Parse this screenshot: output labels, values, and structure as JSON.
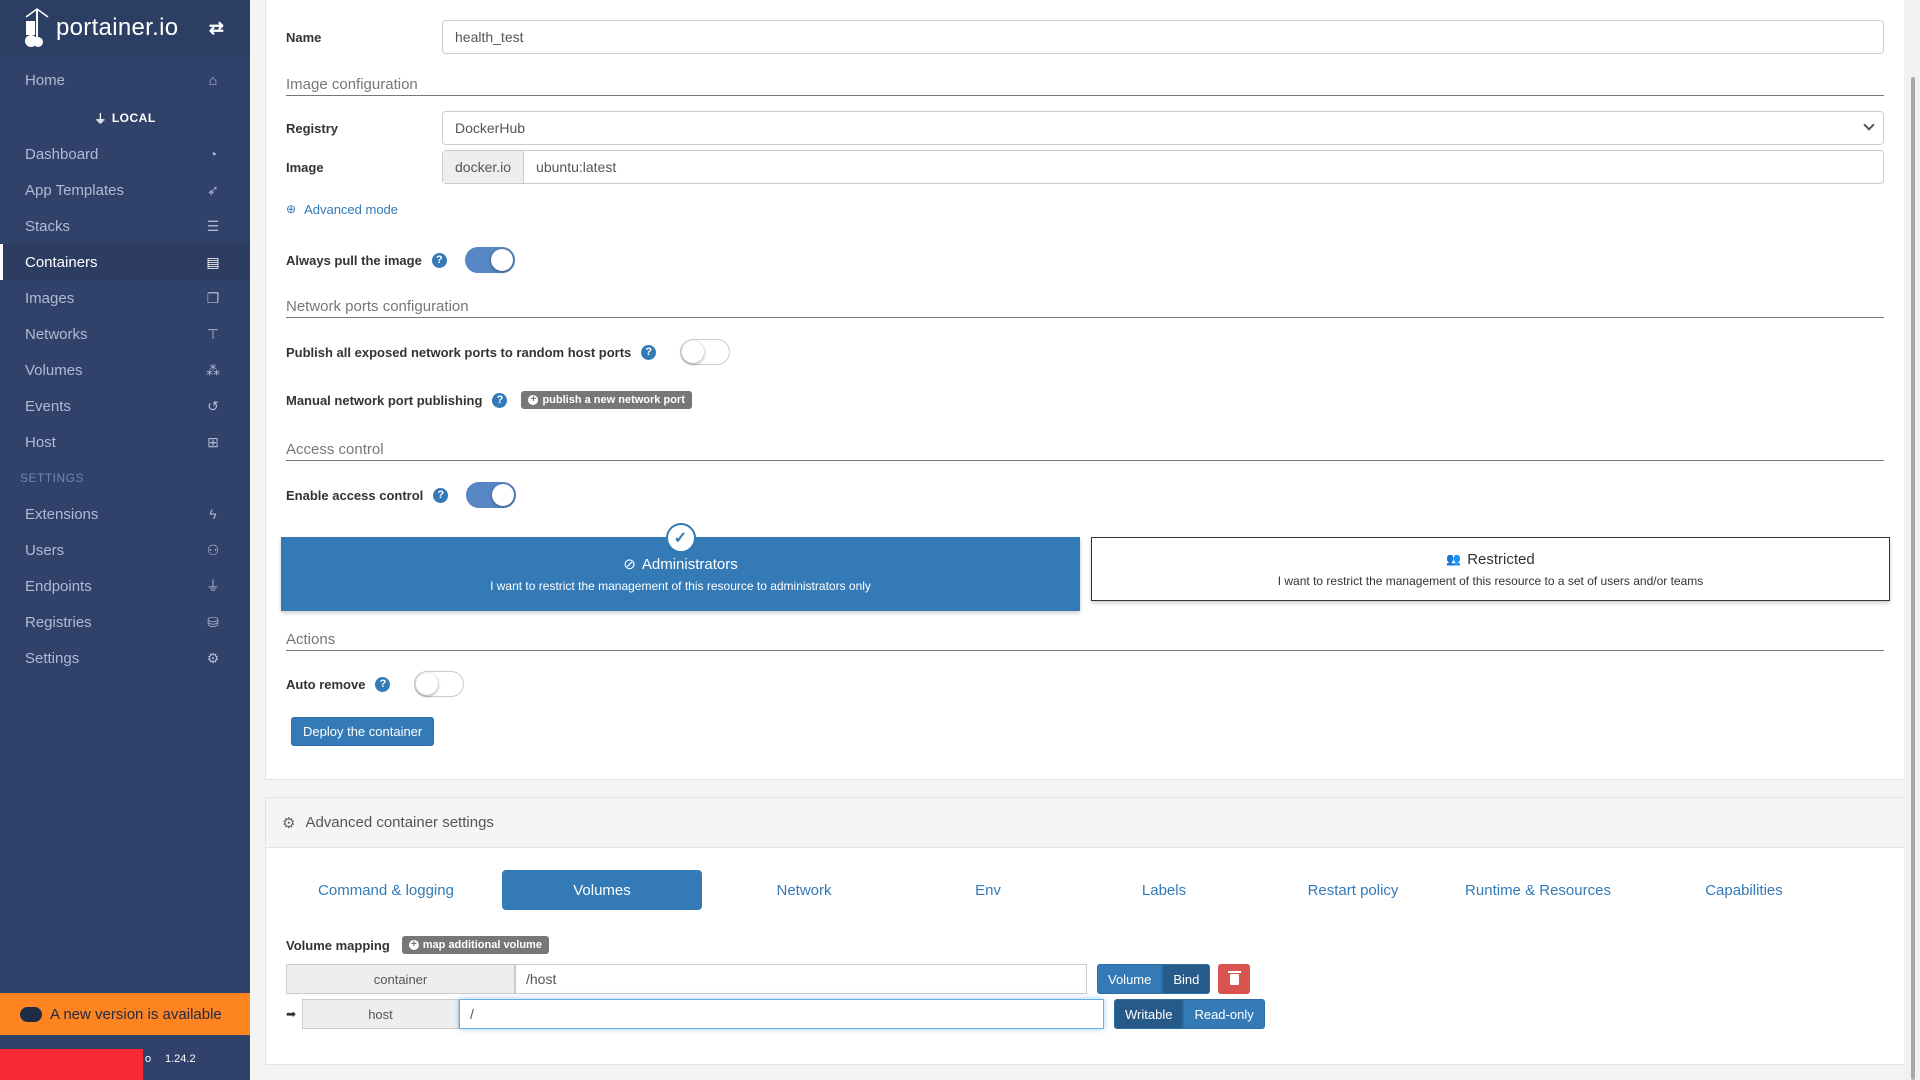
{
  "sidebar": {
    "brand": "portainer.io",
    "home": "Home",
    "endpoint": "LOCAL",
    "items": [
      {
        "label": "Dashboard",
        "icon": "tachometer-icon"
      },
      {
        "label": "App Templates",
        "icon": "rocket-icon"
      },
      {
        "label": "Stacks",
        "icon": "list-icon"
      },
      {
        "label": "Containers",
        "icon": "server-icon",
        "active": true
      },
      {
        "label": "Images",
        "icon": "clone-icon"
      },
      {
        "label": "Networks",
        "icon": "sitemap-icon"
      },
      {
        "label": "Volumes",
        "icon": "cubes-icon"
      },
      {
        "label": "Events",
        "icon": "history-icon"
      },
      {
        "label": "Host",
        "icon": "th-icon"
      }
    ],
    "settings_title": "SETTINGS",
    "settings_items": [
      {
        "label": "Extensions",
        "icon": "bolt-icon"
      },
      {
        "label": "Users",
        "icon": "users-icon"
      },
      {
        "label": "Endpoints",
        "icon": "plug-icon"
      },
      {
        "label": "Registries",
        "icon": "database-icon"
      },
      {
        "label": "Settings",
        "icon": "cogs-icon"
      }
    ],
    "update_banner": "A new version is available",
    "version_prefix": "o",
    "version": "1.24.2"
  },
  "form": {
    "name_label": "Name",
    "name_value": "health_test",
    "image_config_title": "Image configuration",
    "registry_label": "Registry",
    "registry_value": "DockerHub",
    "image_label": "Image",
    "image_prefix": "docker.io",
    "image_value": "ubuntu:latest",
    "advanced_mode": "Advanced mode",
    "always_pull_label": "Always pull the image",
    "always_pull": true,
    "network_title": "Network ports configuration",
    "publish_all_label": "Publish all exposed network ports to random host ports",
    "publish_all": false,
    "manual_publish_label": "Manual network port publishing",
    "publish_new_port": "publish a new network port",
    "access_title": "Access control",
    "enable_access_label": "Enable access control",
    "enable_access": true,
    "admin_title": "Administrators",
    "admin_desc": "I want to restrict the management of this resource to administrators only",
    "restricted_title": "Restricted",
    "restricted_desc": "I want to restrict the management of this resource to a set of users and/or teams",
    "actions_title": "Actions",
    "auto_remove_label": "Auto remove",
    "auto_remove": false,
    "deploy_button": "Deploy the container"
  },
  "advanced": {
    "title": "Advanced container settings",
    "tabs": [
      "Command & logging",
      "Volumes",
      "Network",
      "Env",
      "Labels",
      "Restart policy",
      "Runtime & Resources",
      "Capabilities"
    ],
    "active_tab": "Volumes",
    "volume_mapping_label": "Volume mapping",
    "map_additional": "map additional volume",
    "container_label": "container",
    "container_value": "/host",
    "volume_btn": "Volume",
    "bind_btn": "Bind",
    "host_label": "host",
    "host_value": "/",
    "writable_btn": "Writable",
    "readonly_btn": "Read-only"
  }
}
